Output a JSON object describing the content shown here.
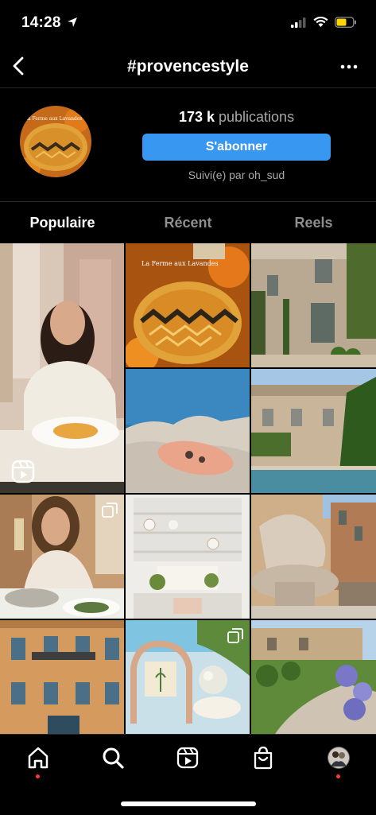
{
  "status": {
    "time": "14:28"
  },
  "nav": {
    "title": "#provencestyle",
    "back_icon": "chevron-left-icon",
    "more_icon": "more-horizontal-icon"
  },
  "profile": {
    "count": "173 k",
    "count_label": "publications",
    "follow_label": "S'abonner",
    "followed_by": "Suivi(e) par oh_sud",
    "avatar_caption": "La Ferme aux Lavandes"
  },
  "tabs": [
    {
      "label": "Populaire",
      "active": true
    },
    {
      "label": "Récent",
      "active": false
    },
    {
      "label": "Reels",
      "active": false
    }
  ],
  "grid": {
    "tile2_caption": "La Ferme aux Lavandes"
  },
  "bottom_nav": [
    {
      "icon": "home-icon",
      "dot": true
    },
    {
      "icon": "search-icon",
      "dot": false
    },
    {
      "icon": "reels-icon",
      "dot": false
    },
    {
      "icon": "shop-icon",
      "dot": false
    },
    {
      "icon": "profile-avatar-icon",
      "dot": true
    }
  ],
  "colors": {
    "accent": "#3897f0",
    "notification": "#ff3b30",
    "battery": "#ffd60a"
  }
}
